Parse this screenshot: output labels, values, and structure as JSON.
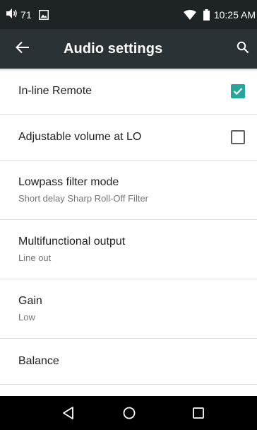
{
  "status_bar": {
    "volume_level": "71",
    "time": "10:25 AM",
    "icons": [
      "volume-icon",
      "image-icon",
      "wifi-icon",
      "battery-icon"
    ]
  },
  "app_bar": {
    "title": "Audio settings",
    "back_icon": "arrow-left-icon",
    "search_icon": "search-icon"
  },
  "settings": [
    {
      "title": "In-line Remote",
      "checkbox": true
    },
    {
      "title": "Adjustable volume at LO",
      "checkbox": false
    },
    {
      "title": "Lowpass filter mode",
      "summary": "Short delay Sharp Roll-Off Filter"
    },
    {
      "title": "Multifunctional output",
      "summary": "Line out"
    },
    {
      "title": "Gain",
      "summary": "Low"
    },
    {
      "title": "Balance"
    }
  ],
  "nav_bar": {
    "icons": [
      "nav-back-icon",
      "nav-home-icon",
      "nav-recents-icon"
    ]
  },
  "colors": {
    "status_bar": "#1e2326",
    "app_bar": "#2a3236",
    "accent": "#26a69a",
    "divider": "#dcdcdc"
  }
}
